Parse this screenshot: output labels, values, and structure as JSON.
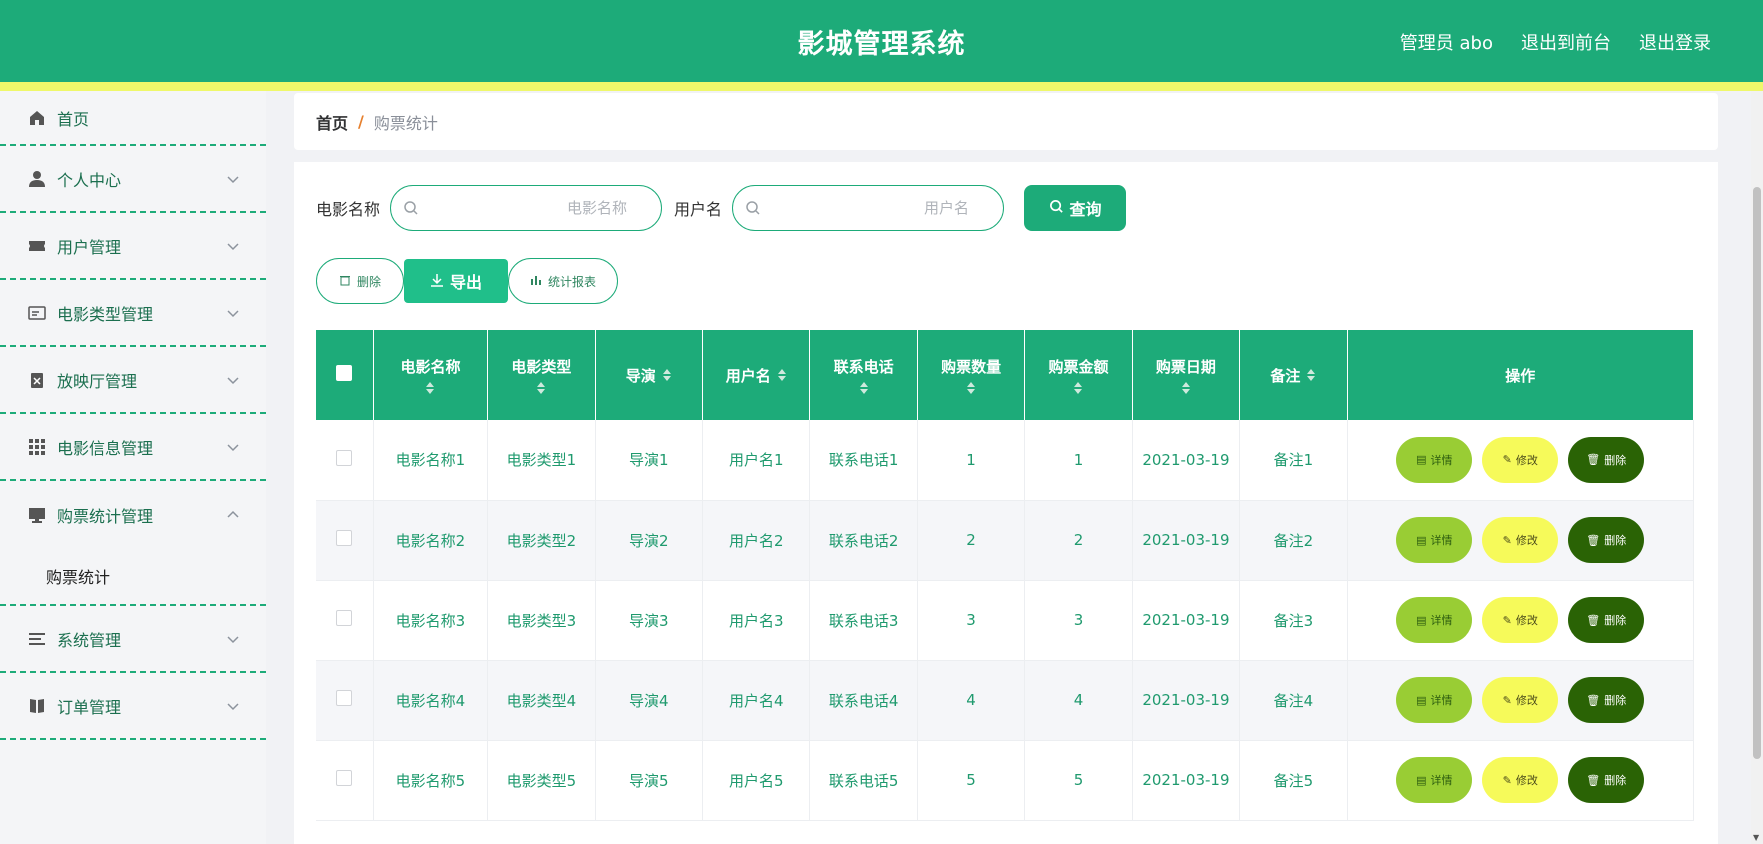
{
  "header": {
    "title": "影城管理系统",
    "admin_label": "管理员 abo",
    "to_front_label": "退出到前台",
    "logout_label": "退出登录"
  },
  "sidebar": {
    "items": [
      {
        "label": "首页",
        "icon": "home-icon"
      },
      {
        "label": "个人中心",
        "icon": "user-icon"
      },
      {
        "label": "用户管理",
        "icon": "ticket-icon"
      },
      {
        "label": "电影类型管理",
        "icon": "card-icon"
      },
      {
        "label": "放映厅管理",
        "icon": "clipboard-icon"
      },
      {
        "label": "电影信息管理",
        "icon": "grid-icon"
      },
      {
        "label": "购票统计管理",
        "icon": "monitor-icon"
      },
      {
        "label": "系统管理",
        "icon": "list-icon"
      },
      {
        "label": "订单管理",
        "icon": "book-icon"
      }
    ],
    "submenu_label": "购票统计"
  },
  "breadcrumb": {
    "home": "首页",
    "separator": "/",
    "current": "购票统计"
  },
  "search": {
    "movie_label": "电影名称",
    "movie_placeholder": "电影名称",
    "user_label": "用户名",
    "user_placeholder": "用户名",
    "query_label": "查询"
  },
  "actions": {
    "delete_label": "删除",
    "export_label": "导出",
    "stats_label": "统计报表"
  },
  "table": {
    "columns": [
      "电影名称",
      "电影类型",
      "导演",
      "用户名",
      "联系电话",
      "购票数量",
      "购票金额",
      "购票日期",
      "备注",
      "操作"
    ],
    "rows": [
      {
        "movie": "电影名称1",
        "type": "电影类型1",
        "director": "导演1",
        "user": "用户名1",
        "phone": "联系电话1",
        "qty": "1",
        "amount": "1",
        "date": "2021-03-19",
        "note": "备注1"
      },
      {
        "movie": "电影名称2",
        "type": "电影类型2",
        "director": "导演2",
        "user": "用户名2",
        "phone": "联系电话2",
        "qty": "2",
        "amount": "2",
        "date": "2021-03-19",
        "note": "备注2"
      },
      {
        "movie": "电影名称3",
        "type": "电影类型3",
        "director": "导演3",
        "user": "用户名3",
        "phone": "联系电话3",
        "qty": "3",
        "amount": "3",
        "date": "2021-03-19",
        "note": "备注3"
      },
      {
        "movie": "电影名称4",
        "type": "电影类型4",
        "director": "导演4",
        "user": "用户名4",
        "phone": "联系电话4",
        "qty": "4",
        "amount": "4",
        "date": "2021-03-19",
        "note": "备注4"
      },
      {
        "movie": "电影名称5",
        "type": "电影类型5",
        "director": "导演5",
        "user": "用户名5",
        "phone": "联系电话5",
        "qty": "5",
        "amount": "5",
        "date": "2021-03-19",
        "note": "备注5"
      }
    ],
    "op_detail": "详情",
    "op_edit": "修改",
    "op_delete": "删除"
  },
  "colors": {
    "primary": "#1dab79",
    "accent_bar": "#eff86a",
    "detail": "#99cd34",
    "edit": "#f6fa5a",
    "delete": "#2a6305"
  }
}
